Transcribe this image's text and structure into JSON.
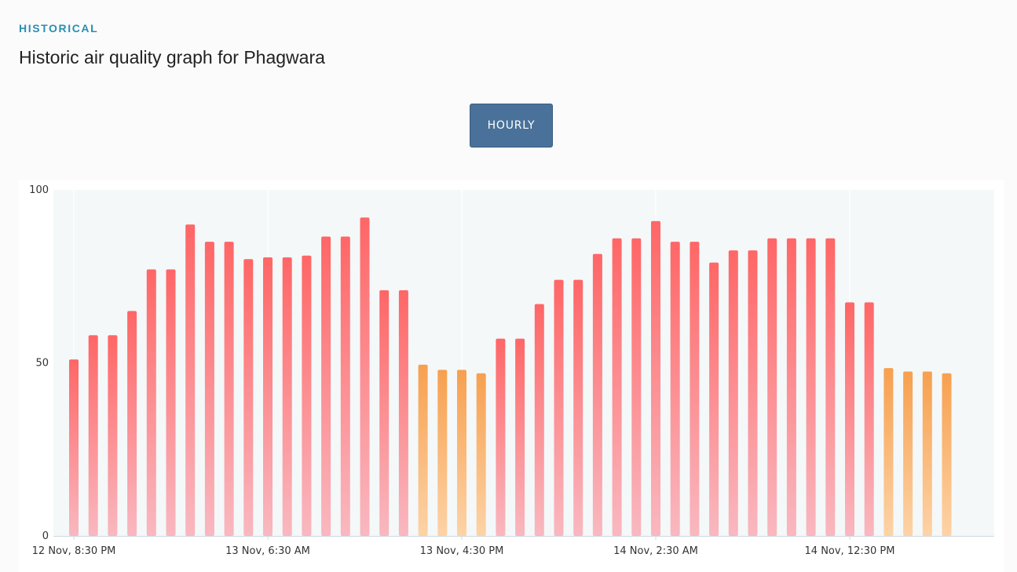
{
  "header": {
    "section_label": "HISTORICAL",
    "title": "Historic air quality graph for Phagwara"
  },
  "controls": {
    "granularity_button": "HOURLY"
  },
  "colors": {
    "section_label": "#2a8fb0",
    "button_bg": "#4a7199",
    "red_bar_top": "#ff6666",
    "red_bar_bottom": "#f9b8c0",
    "orange_bar_top": "#f7a04f",
    "orange_bar_bottom": "#fdd3a6",
    "plot_bg": "#f4f8f9"
  },
  "chart_data": {
    "type": "bar",
    "title": "",
    "xlabel": "",
    "ylabel": "",
    "ylim": [
      0,
      100
    ],
    "yticks": [
      0,
      50,
      100
    ],
    "grid": true,
    "x_tick_labels": [
      {
        "index": 0,
        "label": "12 Nov, 8:30 PM"
      },
      {
        "index": 10,
        "label": "13 Nov, 6:30 AM"
      },
      {
        "index": 20,
        "label": "13 Nov, 4:30 PM"
      },
      {
        "index": 30,
        "label": "14 Nov, 2:30 AM"
      },
      {
        "index": 40,
        "label": "14 Nov, 12:30 PM"
      }
    ],
    "values": [
      51,
      58,
      58,
      65,
      77,
      77,
      90,
      85,
      85,
      80,
      80.5,
      80.5,
      81,
      86.5,
      86.5,
      92,
      71,
      71,
      49.5,
      48,
      48,
      47,
      57,
      57,
      67,
      74,
      74,
      81.5,
      86,
      86,
      91,
      85,
      85,
      79,
      82.5,
      82.5,
      86,
      86,
      86,
      86,
      67.5,
      67.5,
      48.5,
      47.5,
      47.5,
      47
    ]
  }
}
